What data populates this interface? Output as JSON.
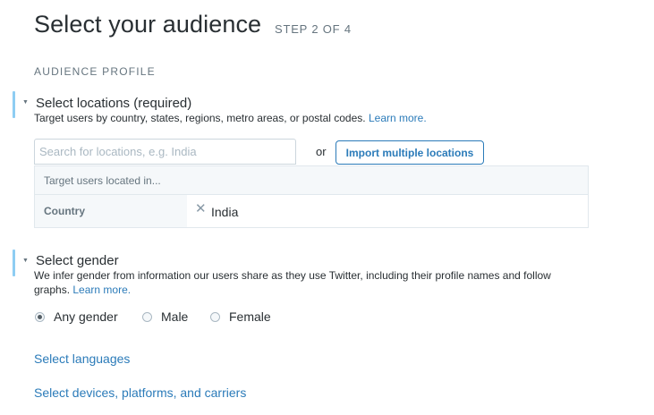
{
  "header": {
    "title": "Select your audience",
    "step": "STEP 2 OF 4"
  },
  "section_label": "AUDIENCE PROFILE",
  "locations": {
    "title": "Select locations (required)",
    "description": "Target users by country, states, regions, metro areas, or postal codes.",
    "learn_more": "Learn more.",
    "search_placeholder": "Search for locations, e.g. India",
    "search_value": "",
    "or_text": "or",
    "import_button": "Import multiple locations",
    "target_header": "Target users located in...",
    "rows": [
      {
        "type": "Country",
        "value": "India"
      }
    ]
  },
  "gender": {
    "title": "Select gender",
    "description_line1": "We infer gender from information our users share as they use Twitter, including their profile names and follow",
    "description_line2": "graphs.",
    "learn_more": "Learn more.",
    "options": [
      "Any gender",
      "Male",
      "Female"
    ],
    "selected": "Any gender"
  },
  "links": {
    "languages": "Select languages",
    "devices": "Select devices, platforms, and carriers"
  },
  "colors": {
    "accent": "#8ecdf3",
    "link": "#2b7bb9",
    "text": "#292f33",
    "muted": "#66757f"
  }
}
